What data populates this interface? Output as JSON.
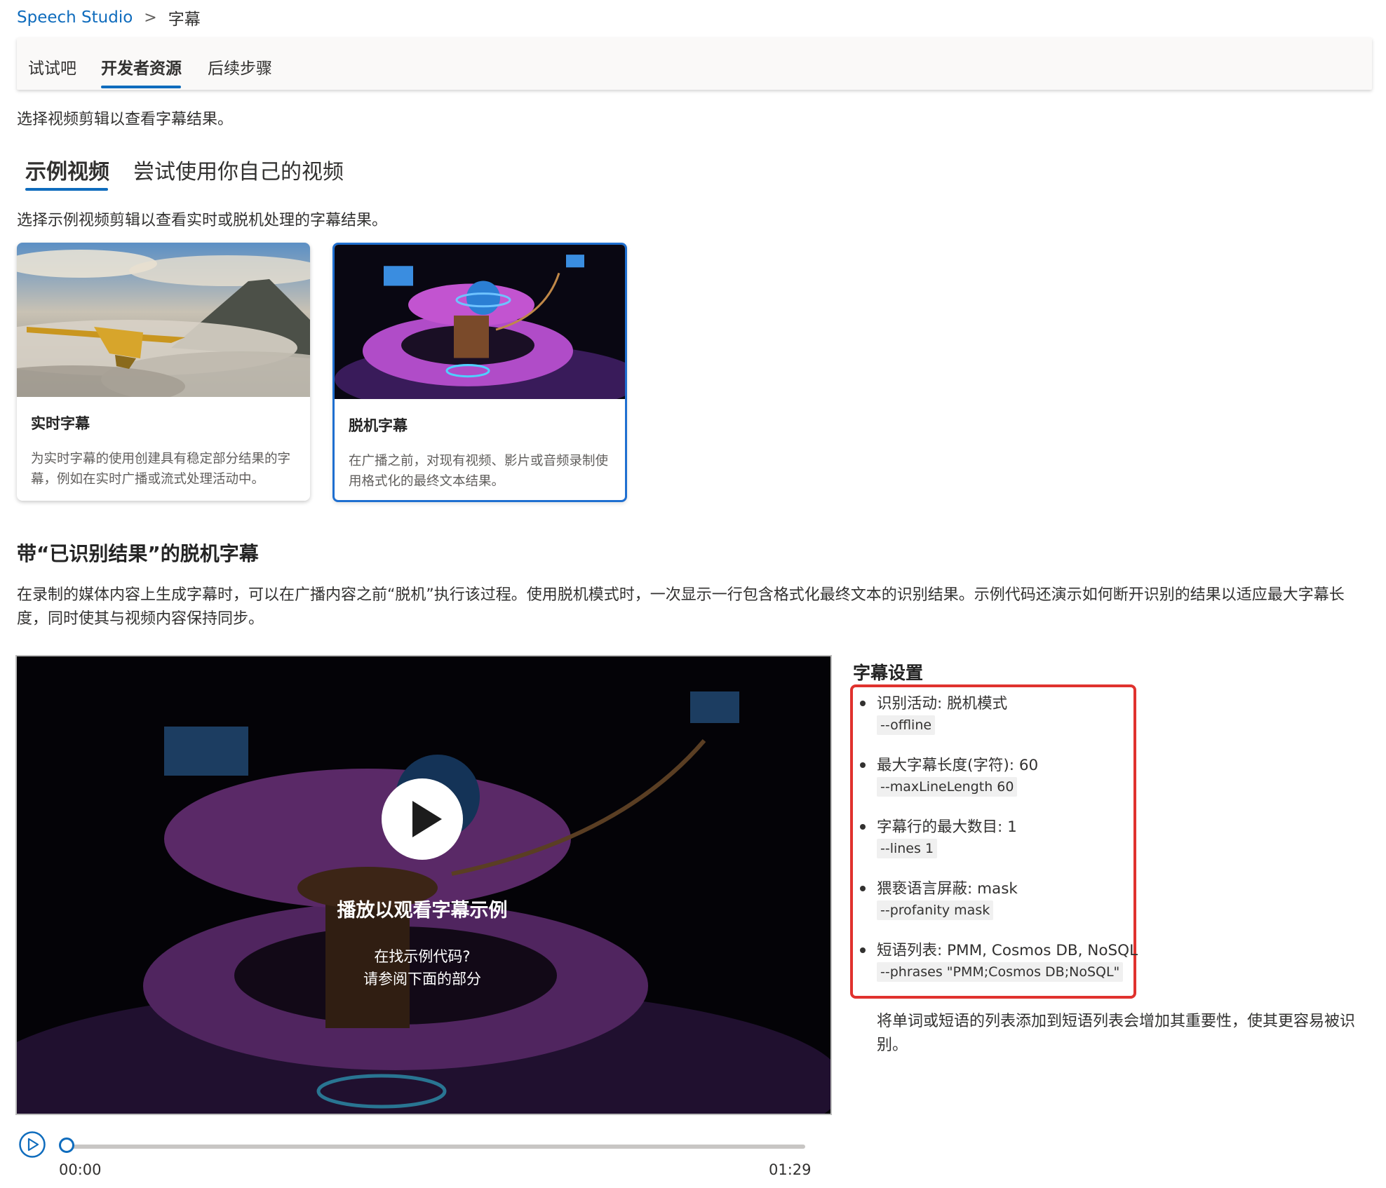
{
  "breadcrumb": {
    "root": "Speech Studio",
    "separator": ">",
    "current": "字幕"
  },
  "top_tabs": [
    {
      "label": "试试吧"
    },
    {
      "label": "开发者资源"
    },
    {
      "label": "后续步骤"
    }
  ],
  "intro": "选择视频剪辑以查看字幕结果。",
  "video_tabs": [
    {
      "label": "示例视频"
    },
    {
      "label": "尝试使用你自己的视频"
    }
  ],
  "example_intro": "选择示例视频剪辑以查看实时或脱机处理的字幕结果。",
  "cards": [
    {
      "title": "实时字幕",
      "description": "为实时字幕的使用创建具有稳定部分结果的字幕，例如在实时广播或流式处理活动中。"
    },
    {
      "title": "脱机字幕",
      "description": "在广播之前，对现有视频、影片或音频录制使用格式化的最终文本结果。"
    }
  ],
  "section": {
    "heading": "带“已识别结果”的脱机字幕",
    "body": "在录制的媒体内容上生成字幕时，可以在广播内容之前“脱机”执行该过程。使用脱机模式时，一次显示一行包含格式化最终文本的识别结果。示例代码还演示如何断开识别的结果以适应最大字幕长度，同时使其与视频内容保持同步。"
  },
  "video": {
    "overlay_title": "播放以观看字幕示例",
    "overlay_line1": "在找示例代码?",
    "overlay_line2": "请参阅下面的部分",
    "current_time": "00:00",
    "duration": "01:29",
    "progress": 0
  },
  "settings": {
    "heading": "字幕设置",
    "items": [
      {
        "label": "识别活动: 脱机模式",
        "code": "--offline"
      },
      {
        "label": "最大字幕长度(字符): 60",
        "code": "--maxLineLength 60"
      },
      {
        "label": "字幕行的最大数目: 1",
        "code": "--lines 1"
      },
      {
        "label": "猥亵语言屏蔽: mask",
        "code": "--profanity mask"
      },
      {
        "label": "短语列表: PMM, Cosmos DB, NoSQL",
        "code": "--phrases \"PMM;Cosmos DB;NoSQL\""
      }
    ],
    "note": "将单词或短语的列表添加到短语列表会增加其重要性，使其更容易被识别。"
  },
  "colors": {
    "accent": "#0f6cbd",
    "highlight_box": "#e0322e"
  }
}
